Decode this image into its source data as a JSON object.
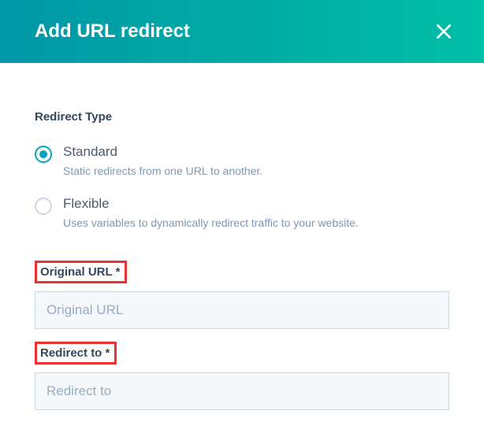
{
  "header": {
    "title": "Add URL redirect"
  },
  "form": {
    "type_label": "Redirect Type",
    "options": {
      "standard": {
        "title": "Standard",
        "description": "Static redirects from one URL to another."
      },
      "flexible": {
        "title": "Flexible",
        "description": "Uses variables to dynamically redirect traffic to your website."
      }
    },
    "original_url": {
      "label": "Original URL *",
      "placeholder": "Original URL",
      "value": ""
    },
    "redirect_to": {
      "label": "Redirect to *",
      "placeholder": "Redirect to",
      "value": ""
    }
  }
}
